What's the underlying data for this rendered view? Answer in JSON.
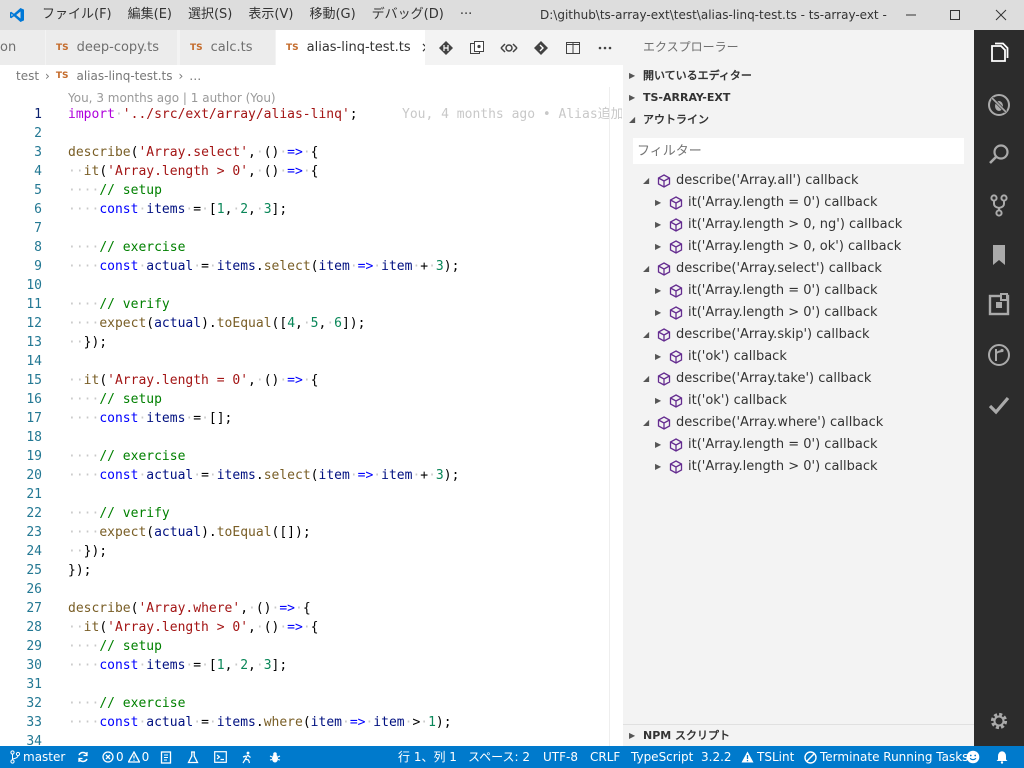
{
  "window": {
    "title": "D:\\github\\ts-array-ext\\test\\alias-linq-test.ts - ts-array-ext - Visu...",
    "menus": [
      "ファイル(F)",
      "編集(E)",
      "選択(S)",
      "表示(V)",
      "移動(G)",
      "デバッグ(D)",
      "···"
    ]
  },
  "tabs": [
    {
      "label": "on",
      "badge": "",
      "active": false
    },
    {
      "label": "deep-copy.ts",
      "badge": "TS",
      "active": false
    },
    {
      "label": "calc.ts",
      "badge": "TS",
      "active": false
    },
    {
      "label": "alias-linq-test.ts",
      "badge": "TS",
      "active": true,
      "close": "×"
    }
  ],
  "breadcrumb": {
    "folder": "test",
    "sep": "›",
    "badge": "TS",
    "file": "alias-linq-test.ts",
    "more": "…"
  },
  "editor": {
    "codelens": "You, 3 months ago | 1 author (You)",
    "blame": "You, 4 months ago • Alias追加",
    "lines": [
      {
        "n": "1",
        "text": "import '../src/ext/array/alias-linq';"
      },
      {
        "n": "2",
        "text": ""
      },
      {
        "n": "3",
        "text": "describe('Array.select', () => {"
      },
      {
        "n": "4",
        "text": "  it('Array.length > 0', () => {"
      },
      {
        "n": "5",
        "text": "    // setup"
      },
      {
        "n": "6",
        "text": "    const items = [1, 2, 3];"
      },
      {
        "n": "7",
        "text": ""
      },
      {
        "n": "8",
        "text": "    // exercise"
      },
      {
        "n": "9",
        "text": "    const actual = items.select(item => item + 3);"
      },
      {
        "n": "10",
        "text": ""
      },
      {
        "n": "11",
        "text": "    // verify"
      },
      {
        "n": "12",
        "text": "    expect(actual).toEqual([4, 5, 6]);"
      },
      {
        "n": "13",
        "text": "  });"
      },
      {
        "n": "14",
        "text": ""
      },
      {
        "n": "15",
        "text": "  it('Array.length = 0', () => {"
      },
      {
        "n": "16",
        "text": "    // setup"
      },
      {
        "n": "17",
        "text": "    const items = [];"
      },
      {
        "n": "18",
        "text": ""
      },
      {
        "n": "19",
        "text": "    // exercise"
      },
      {
        "n": "20",
        "text": "    const actual = items.select(item => item + 3);"
      },
      {
        "n": "21",
        "text": ""
      },
      {
        "n": "22",
        "text": "    // verify"
      },
      {
        "n": "23",
        "text": "    expect(actual).toEqual([]);"
      },
      {
        "n": "24",
        "text": "  });"
      },
      {
        "n": "25",
        "text": "});"
      },
      {
        "n": "26",
        "text": ""
      },
      {
        "n": "27",
        "text": "describe('Array.where', () => {"
      },
      {
        "n": "28",
        "text": "  it('Array.length > 0', () => {"
      },
      {
        "n": "29",
        "text": "    // setup"
      },
      {
        "n": "30",
        "text": "    const items = [1, 2, 3];"
      },
      {
        "n": "31",
        "text": ""
      },
      {
        "n": "32",
        "text": "    // exercise"
      },
      {
        "n": "33",
        "text": "    const actual = items.where(item => item > 1);"
      },
      {
        "n": "34",
        "text": ""
      }
    ]
  },
  "sidebar": {
    "title": "エクスプローラー",
    "sections": {
      "open_editors": "開いているエディター",
      "project": "TS-ARRAY-EXT",
      "outline": "アウトライン",
      "npm": "NPM スクリプト"
    },
    "filter_placeholder": "フィルター",
    "outline": [
      {
        "label": "describe('Array.all') callback",
        "level": 0
      },
      {
        "label": "it('Array.length = 0') callback",
        "level": 1
      },
      {
        "label": "it('Array.length > 0, ng') callback",
        "level": 1
      },
      {
        "label": "it('Array.length > 0, ok') callback",
        "level": 1
      },
      {
        "label": "describe('Array.select') callback",
        "level": 0
      },
      {
        "label": "it('Array.length = 0') callback",
        "level": 1
      },
      {
        "label": "it('Array.length > 0') callback",
        "level": 1
      },
      {
        "label": "describe('Array.skip') callback",
        "level": 0
      },
      {
        "label": "it('ok') callback",
        "level": 1
      },
      {
        "label": "describe('Array.take') callback",
        "level": 0
      },
      {
        "label": "it('ok') callback",
        "level": 1
      },
      {
        "label": "describe('Array.where') callback",
        "level": 0
      },
      {
        "label": "it('Array.length = 0') callback",
        "level": 1
      },
      {
        "label": "it('Array.length > 0') callback",
        "level": 1
      }
    ]
  },
  "statusbar": {
    "branch": "master",
    "errors": "0",
    "warnings": "0",
    "position": "行 1、列 1",
    "spaces": "スペース: 2",
    "encoding": "UTF-8",
    "eol": "CRLF",
    "language": "TypeScript",
    "version": "3.2.2",
    "tslint": "TSLint",
    "terminate": "Terminate Running Tasks"
  },
  "colors": {
    "keyword": "#af00db",
    "string": "#a31515",
    "comment": "#008000",
    "number": "#098658",
    "storage": "#0000ff",
    "variable": "#001080",
    "function": "#795e26",
    "whitespace": "#c8c8c8",
    "accent": "#007acc",
    "symbol": "#652d90"
  },
  "icons": {
    "app": "vscode-icon",
    "tab_actions": [
      "git-compare-icon",
      "open-changes-icon",
      "blame-icon",
      "next-change-icon",
      "split-editor-icon",
      "more-icon"
    ],
    "activity": [
      "files-icon",
      "no-debug-icon",
      "search-icon",
      "source-control-icon",
      "bookmarks-icon",
      "extensions-icon",
      "git-history-icon",
      "tasks-check-icon",
      "settings-gear-icon"
    ]
  }
}
